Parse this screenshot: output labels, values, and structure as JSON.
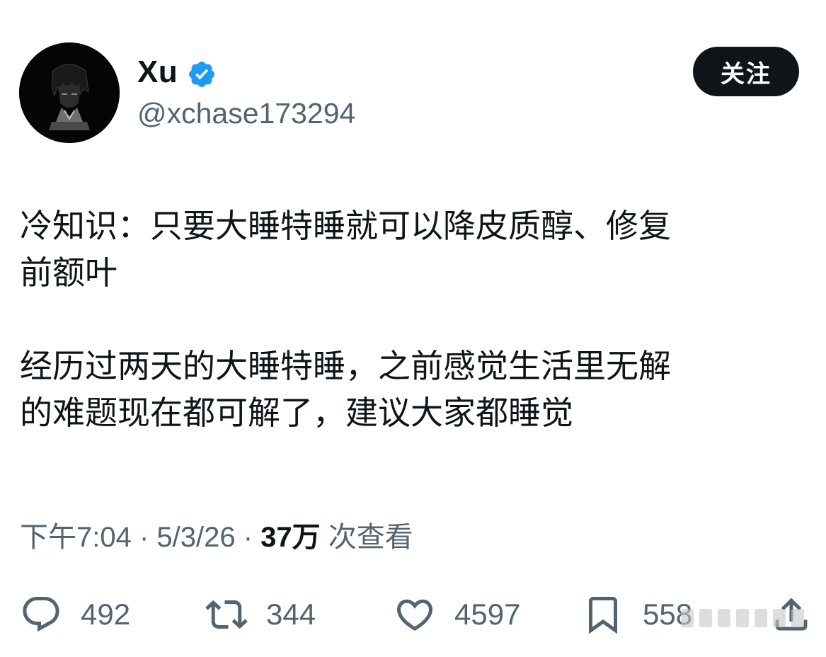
{
  "author": {
    "display_name": "Xu",
    "handle": "@xchase173294",
    "verified": true,
    "avatar_icon": "anime-character-avatar"
  },
  "follow_button": {
    "label": "关注"
  },
  "tweet": {
    "paragraph_1": "冷知识：只要大睡特睡就可以降皮质醇、修复\n前额叶",
    "paragraph_2": "经历过两天的大睡特睡，之前感觉生活里无解\n的难题现在都可解了，建议大家都睡觉"
  },
  "meta": {
    "time": "下午7:04",
    "separator_1": " · ",
    "date": "5/3/26",
    "separator_2": " · ",
    "views_count": "37万",
    "views_label": " 次查看"
  },
  "actions": {
    "replies": "492",
    "reposts": "344",
    "likes": "4597",
    "bookmarks": "558"
  },
  "colors": {
    "text_primary": "#0f1419",
    "text_secondary": "#536471",
    "verified_blue": "#1d9bf0",
    "button_bg": "#0f1419"
  }
}
